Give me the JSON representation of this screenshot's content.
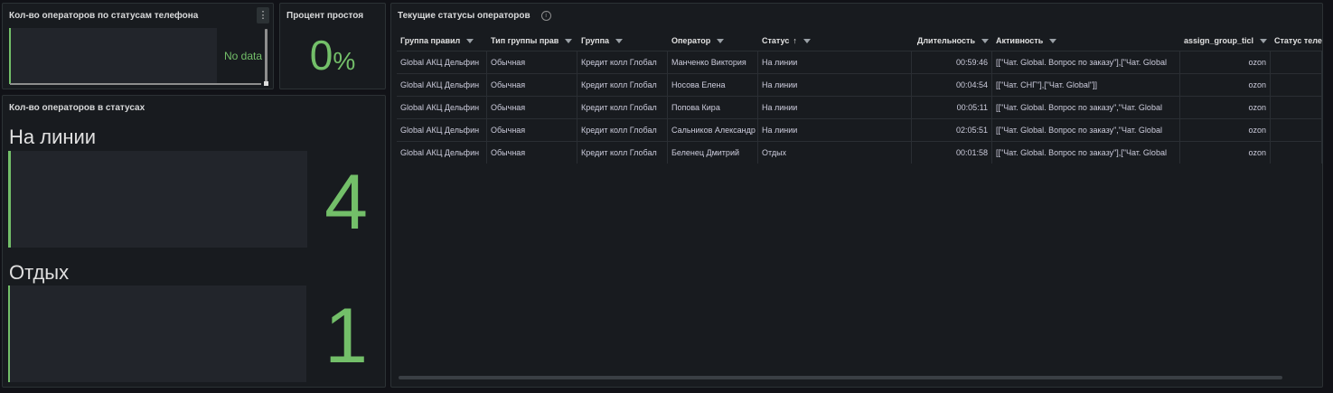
{
  "panels": {
    "phone_status": {
      "title": "Кол-во операторов по статусам телефона",
      "no_data": "No data",
      "menu_icon": "⋮"
    },
    "idle_percent": {
      "title": "Процент простоя",
      "value": "0",
      "unit": "%"
    },
    "status_counts": {
      "title": "Кол-во операторов в статусах",
      "items": [
        {
          "label": "На линии",
          "value": "4"
        },
        {
          "label": "Отдых",
          "value": "1"
        }
      ]
    },
    "current_statuses": {
      "title": "Текущие статусы операторов",
      "info_icon": "i",
      "columns": [
        "Группа правил",
        "Тип группы прав",
        "Группа",
        "Оператор",
        "Статус",
        "Длительность",
        "Активность",
        "assign_group_ticl",
        "Статус теле"
      ],
      "sort_indicator": "↑",
      "rows": [
        [
          "Global АКЦ Дельфин",
          "Обычная",
          "Кредит колл Глобал",
          "Манченко Виктория",
          "На линии",
          "00:59:46",
          "[[\"Чат. Global. Вопрос по заказу\"],[\"Чат. Global",
          "ozon",
          ""
        ],
        [
          "Global АКЦ Дельфин",
          "Обычная",
          "Кредит колл Глобал",
          "Носова Елена",
          "На линии",
          "00:04:54",
          "[[\"Чат. СНГ\"],[\"Чат. Global\"]]",
          "ozon",
          ""
        ],
        [
          "Global АКЦ Дельфин",
          "Обычная",
          "Кредит колл Глобал",
          "Попова Кира",
          "На линии",
          "00:05:11",
          "[[\"Чат. Global. Вопрос по заказу\",\"Чат. Global",
          "ozon",
          ""
        ],
        [
          "Global АКЦ Дельфин",
          "Обычная",
          "Кредит колл Глобал",
          "Сальников Александр",
          "На линии",
          "02:05:51",
          "[[\"Чат. Global. Вопрос по заказу\",\"Чат. Global",
          "ozon",
          ""
        ],
        [
          "Global АКЦ Дельфин",
          "Обычная",
          "Кредит колл Глобал",
          "Беленец Дмитрий",
          "Отдых",
          "00:01:58",
          "[[\"Чат. Global. Вопрос по заказу\"],[\"Чат. Global",
          "ozon",
          ""
        ]
      ]
    }
  },
  "colors": {
    "accent_green": "#73bf69",
    "background": "#111217",
    "panel": "#181b1f"
  }
}
